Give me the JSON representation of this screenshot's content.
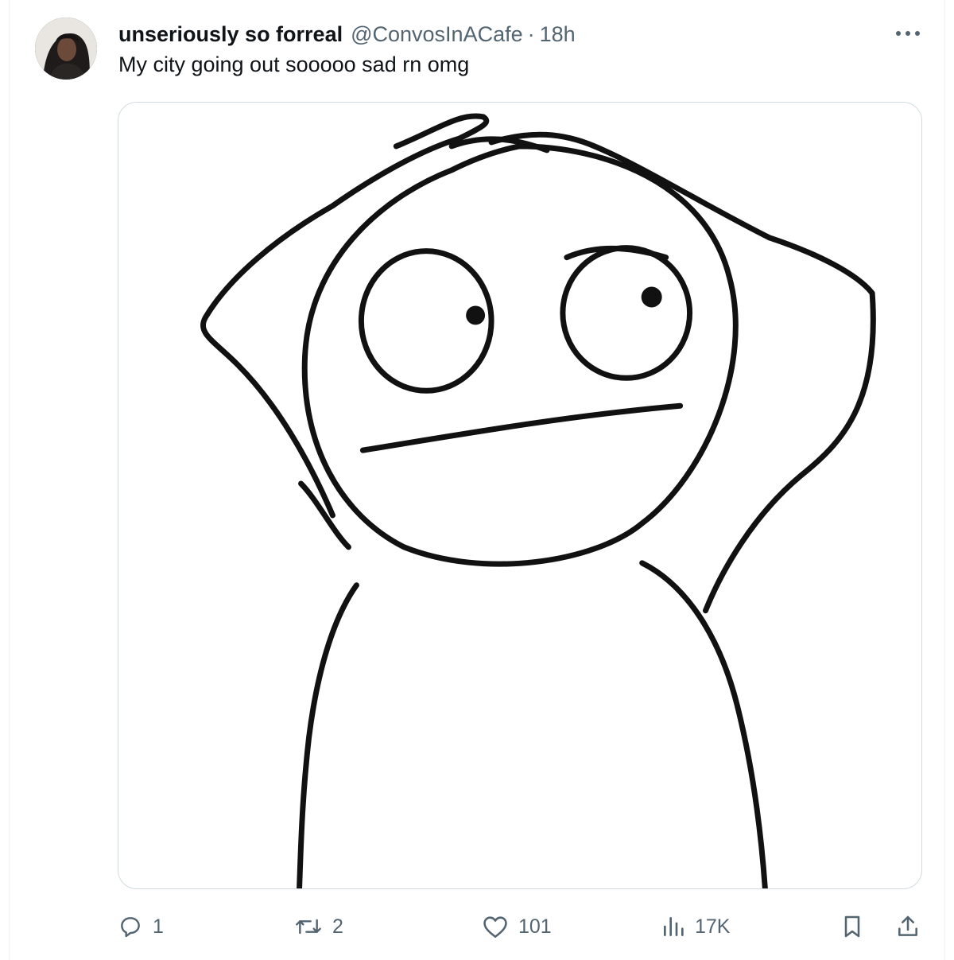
{
  "tweet": {
    "display_name": "unseriously so forreal",
    "handle": "@ConvosInACafe",
    "separator": "·",
    "time": "18h",
    "text": "My city going out sooooo sad rn omg"
  },
  "icons": {
    "more": "more-horizontal-icon",
    "reply": "reply-bubble-icon",
    "retweet": "retweet-arrows-icon",
    "like": "heart-icon",
    "views": "bar-chart-icon",
    "bookmark": "bookmark-icon",
    "share": "share-upload-icon"
  },
  "actions": {
    "reply_count": "1",
    "retweet_count": "2",
    "like_count": "101",
    "views_count": "17K"
  },
  "colors": {
    "text_primary": "#0f1419",
    "text_secondary": "#536471",
    "border": "#cfd9de"
  }
}
